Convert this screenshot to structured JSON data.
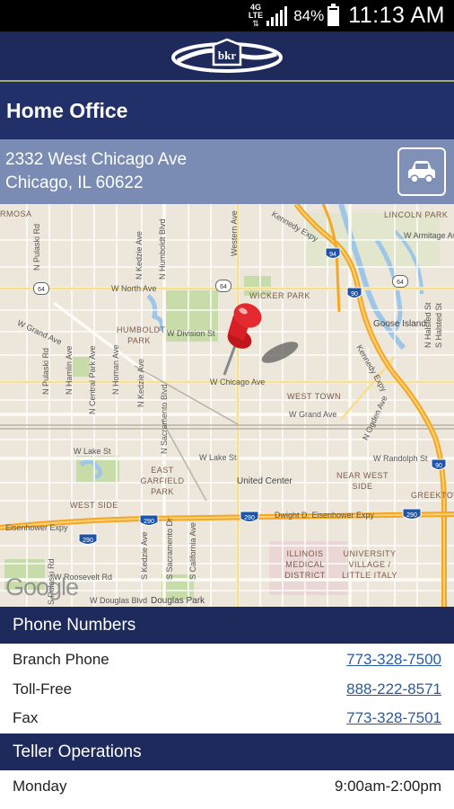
{
  "status_bar": {
    "network": "4G LTE",
    "battery": "84%",
    "battery_level": 0.84,
    "time": "11:13 AM",
    "icons": [
      "network-icon",
      "signal-icon",
      "battery-icon"
    ]
  },
  "header": {
    "logo_icon": "bank-logo-icon",
    "logo_text": "bkr"
  },
  "title": "Home Office",
  "address": {
    "line1": "2332 West Chicago Ave",
    "line2": "Chicago, IL 60622",
    "directions_icon": "car-icon"
  },
  "map": {
    "pin_icon": "map-pin-icon",
    "attribution": "Google",
    "areas": [
      "WICKER PARK",
      "HUMBOLDT PARK",
      "WEST TOWN",
      "EAST GARFIELD PARK",
      "WEST SIDE",
      "NEAR WEST SIDE",
      "UNITED CENTER",
      "ILLINOIS MEDICAL DISTRICT",
      "UNIVERSITY VILLAGE / LITTLE ITALY",
      "GREEKTOWN",
      "LINCOLN PARK",
      "Goose Island",
      "Douglas Park",
      "United Center"
    ],
    "labels": {
      "north_ave": "W North Ave",
      "grand_ave_left": "W Grand Ave",
      "division": "W Division St",
      "chicago_ave": "W Chicago Ave",
      "grand_ave_right": "W Grand Ave",
      "lake_left": "W Lake St",
      "lake_right": "W Lake St",
      "randolph": "W Randolph St",
      "eisenhower_left": "Eisenhower Expy",
      "eisenhower_right": "Dwight D. Eisenhower Expy",
      "roosevelt": "W Roosevelt Rd",
      "douglas": "W Douglas Blvd",
      "kennedy_top": "Kennedy Expy",
      "kennedy_mid": "Kennedy Expy",
      "ogden": "N Ogden Ave",
      "armitage": "W Armitage Ave",
      "rmosa": "RMOSA",
      "pulaski_n": "N Pulaski Rd",
      "pulaski_n2": "N Pulaski Rd",
      "hamlin": "N Hamlin Ave",
      "central_park": "N Central Park Ave",
      "homan": "N Homan Ave",
      "kedzie": "N Kedzie Ave",
      "kedzie2": "N Kedzie Ave",
      "humboldt_blvd": "N Humboldt Blvd",
      "sacramento": "N Sacramento Blvd",
      "western": "Western Ave",
      "halsted": "N Halsted St",
      "halsted_s": "S Halsted St",
      "s_kedzie": "S Kedzie Ave",
      "s_sacramento": "S Sacramento Dr",
      "s_california": "S California Ave",
      "s_pulaski": "S Pulaski Rd",
      "shield_94": "94",
      "shield_90a": "90",
      "shield_90b": "90",
      "shield_290a": "290",
      "shield_290b": "290",
      "shield_290c": "290",
      "shield_290d": "290",
      "shield_64a": "64",
      "shield_64b": "64",
      "shield_64c": "64"
    }
  },
  "phone_section": {
    "title": "Phone Numbers",
    "rows": [
      {
        "label": "Branch Phone",
        "value": "773-328-7500"
      },
      {
        "label": "Toll-Free",
        "value": "888-222-8571"
      },
      {
        "label": "Fax",
        "value": "773-328-7501"
      }
    ]
  },
  "teller_section": {
    "title": "Teller Operations",
    "rows": [
      {
        "label": "Monday",
        "value": "9:00am-2:00pm"
      }
    ]
  },
  "colors": {
    "header": "#1f2a5c",
    "address_bar": "#7a8bb4",
    "link": "#2a5aa6",
    "expressway": "#f5a623"
  }
}
